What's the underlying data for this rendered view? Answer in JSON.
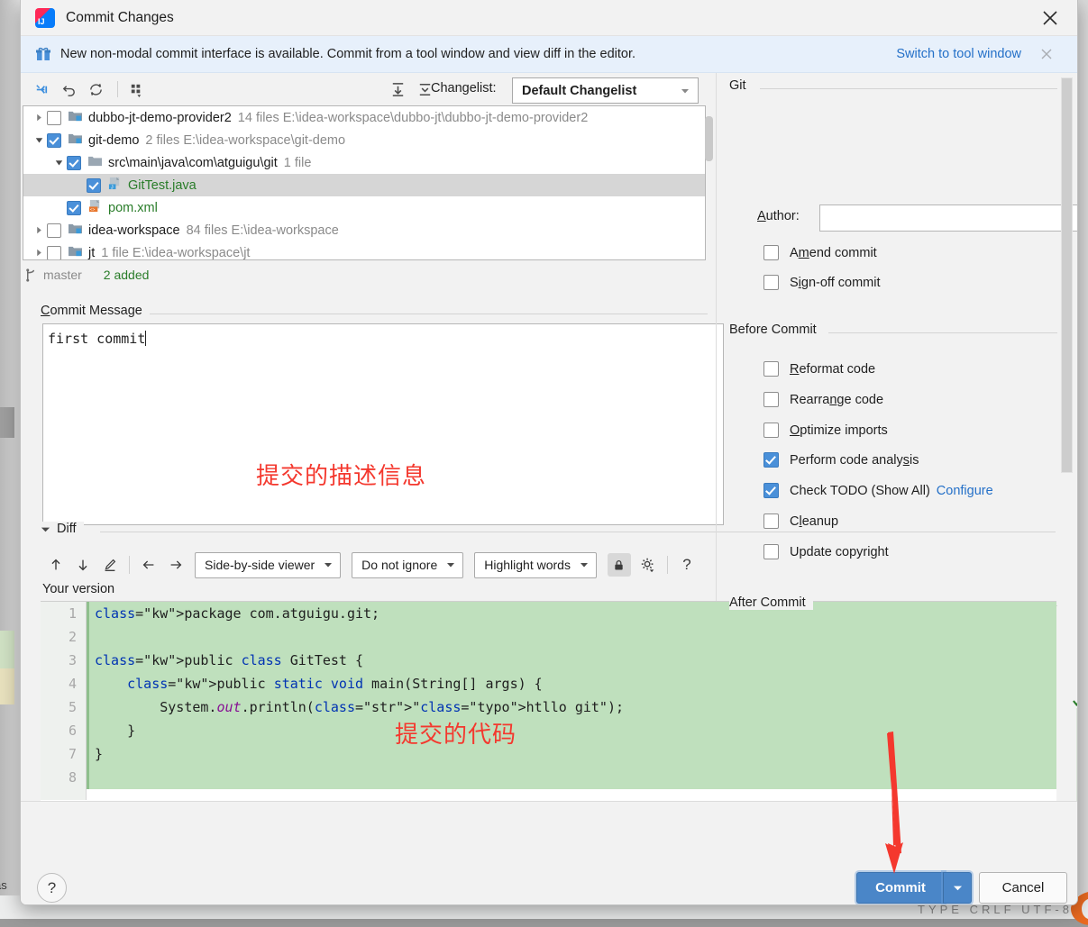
{
  "window": {
    "title": "Commit Changes",
    "logo_text": "IJ",
    "close_icon": "close-icon"
  },
  "notification": {
    "icon": "gift-icon",
    "text": "New non-modal commit interface is available. Commit from a tool window and view diff in the editor.",
    "link": "Switch to tool window",
    "close_icon": "close-icon"
  },
  "tree_toolbar": {
    "buttons": [
      {
        "name": "show-diff-icon",
        "glyph": "collapse-arrow"
      },
      {
        "name": "revert-icon",
        "glyph": "undo"
      },
      {
        "name": "refresh-icon",
        "glyph": "refresh"
      },
      {
        "name": "group-by-icon",
        "glyph": "group"
      }
    ],
    "expand_all_icon": "expand-all-icon",
    "collapse_all_icon": "collapse-all-icon",
    "changelist_label": "Changelist:",
    "changelist_value": "Default Changelist"
  },
  "tree": {
    "rows": [
      {
        "indent": 0,
        "arrow": "collapsed",
        "checked": false,
        "icon": "module-folder-icon",
        "name": "dubbo-jt-demo-provider2",
        "meta": "14 files  E:\\idea-workspace\\dubbo-jt\\dubbo-jt-demo-provider2",
        "selected": false,
        "green": false
      },
      {
        "indent": 0,
        "arrow": "expanded",
        "checked": true,
        "icon": "module-folder-icon",
        "name": "git-demo",
        "meta": "2 files  E:\\idea-workspace\\git-demo",
        "selected": false,
        "green": false
      },
      {
        "indent": 1,
        "arrow": "expanded",
        "checked": true,
        "icon": "folder-icon",
        "name": "src\\main\\java\\com\\atguigu\\git",
        "meta": "1 file",
        "selected": false,
        "green": false
      },
      {
        "indent": 2,
        "arrow": "none",
        "checked": true,
        "icon": "java-file-icon",
        "name": "GitTest.java",
        "meta": "",
        "selected": true,
        "green": true
      },
      {
        "indent": 1,
        "arrow": "none",
        "checked": true,
        "icon": "xml-file-icon",
        "name": "pom.xml",
        "meta": "",
        "selected": false,
        "green": true
      },
      {
        "indent": 0,
        "arrow": "collapsed",
        "checked": false,
        "icon": "module-folder-icon",
        "name": "idea-workspace",
        "meta": "84 files  E:\\idea-workspace",
        "selected": false,
        "green": false
      },
      {
        "indent": 0,
        "arrow": "collapsed",
        "checked": false,
        "icon": "module-folder-icon",
        "name": "jt",
        "meta": "1 file  E:\\idea-workspace\\jt",
        "selected": false,
        "green": false
      }
    ]
  },
  "branch_bar": {
    "icon": "branch-icon",
    "branch": "master",
    "added": "2 added"
  },
  "commit_message": {
    "legend": "Commit Message",
    "legend_mnemonic": "C",
    "history_icon": "clock-icon",
    "value": "first commit"
  },
  "annotations": {
    "message_note": "提交的描述信息",
    "code_note": "提交的代码",
    "arrow_color": "#f4382e"
  },
  "diff": {
    "legend": "Diff",
    "toolbar": {
      "prev_icon": "arrow-up-icon",
      "next_icon": "arrow-down-icon",
      "edit_icon": "pencil-icon",
      "left_icon": "arrow-left-icon",
      "right_icon": "arrow-right-icon",
      "viewer_mode": "Side-by-side viewer",
      "ignore_mode": "Do not ignore",
      "highlight_mode": "Highlight words",
      "lock_icon": "lock-icon",
      "settings_icon": "gear-icon",
      "help_icon": "question-icon"
    },
    "version_label": "Your version",
    "check_icon": "checkmark-icon",
    "line_numbers": [
      "1",
      "2",
      "3",
      "4",
      "5",
      "6",
      "7",
      "8"
    ],
    "code_lines": [
      "package com.atguigu.git;",
      "",
      "public class GitTest {",
      "    public static void main(String[] args) {",
      "        System.out.println(\"htllo git\");",
      "    }",
      "}",
      ""
    ]
  },
  "right_panel": {
    "git_group": "Git",
    "author_label": "Author:",
    "author_mnemonic": "A",
    "author_value": "",
    "git_options": [
      {
        "label": "Amend commit",
        "checked": false,
        "mnemonic_index": 2
      },
      {
        "label": "Sign-off commit",
        "checked": false,
        "mnemonic_index": 1
      }
    ],
    "before_commit_group": "Before Commit",
    "before_commit_options": [
      {
        "label": "Reformat code",
        "checked": false
      },
      {
        "label": "Rearrange code",
        "checked": false
      },
      {
        "label": "Optimize imports",
        "checked": false
      },
      {
        "label": "Perform code analysis",
        "checked": true
      },
      {
        "label": "Check TODO (Show All)",
        "checked": true,
        "link": "Configure"
      },
      {
        "label": "Cleanup",
        "checked": false
      },
      {
        "label": "Update copyright",
        "checked": false
      }
    ],
    "after_commit_group": "After Commit"
  },
  "footer": {
    "help_label": "?",
    "commit_label": "Commit",
    "commit_dropdown_icon": "chevron-down-icon",
    "cancel_label": "Cancel"
  },
  "background": {
    "bottom_text": "TYPE  CRLF  UTF-8",
    "left_text": "as"
  },
  "colors": {
    "accent": "#4a86c8",
    "link": "#2470c8",
    "added_green": "#2a7d2a",
    "diff_green": "#bfe0bd",
    "annotation_red": "#f4382e"
  }
}
